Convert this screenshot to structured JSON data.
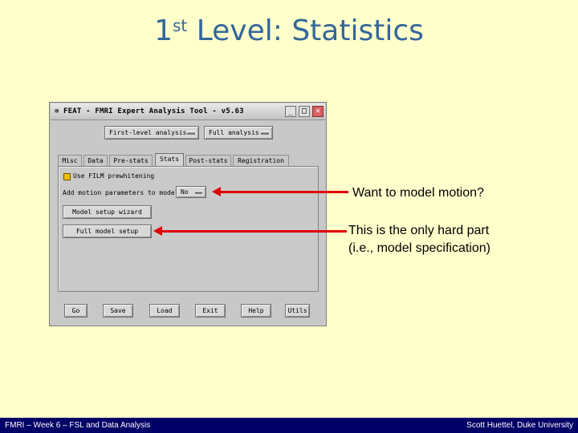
{
  "slide": {
    "title_prefix": "1",
    "title_sup": "st",
    "title_rest": " Level: Statistics"
  },
  "window": {
    "title": "FEAT - FMRI Expert Analysis Tool - v5.63",
    "analysis_level": "First-level analysis",
    "analysis_type": "Full analysis",
    "tabs": [
      "Misc",
      "Data",
      "Pre-stats",
      "Stats",
      "Post-stats",
      "Registration"
    ],
    "active_tab": "Stats",
    "fild_checkbox_label": "Use FILM prewhitening",
    "motion_label": "Add motion parameters to model",
    "motion_value": "No",
    "model_wizard_label": "Model setup wizard",
    "full_model_label": "Full model setup",
    "bottom_buttons": [
      "Go",
      "Save",
      "Load",
      "Exit",
      "Help",
      "Utils"
    ]
  },
  "annotations": {
    "motion_note": "Want to model motion?",
    "model_note_line1": "This is the only hard part",
    "model_note_line2": "(i.e., model specification)"
  },
  "footer": {
    "left": "FMRI – Week 6 – FSL and Data Analysis",
    "right": "Scott Huettel, Duke University"
  },
  "colors": {
    "background": "#ffffcc",
    "title": "#336699",
    "arrow": "#dd0000",
    "footer_bg": "#000066"
  }
}
